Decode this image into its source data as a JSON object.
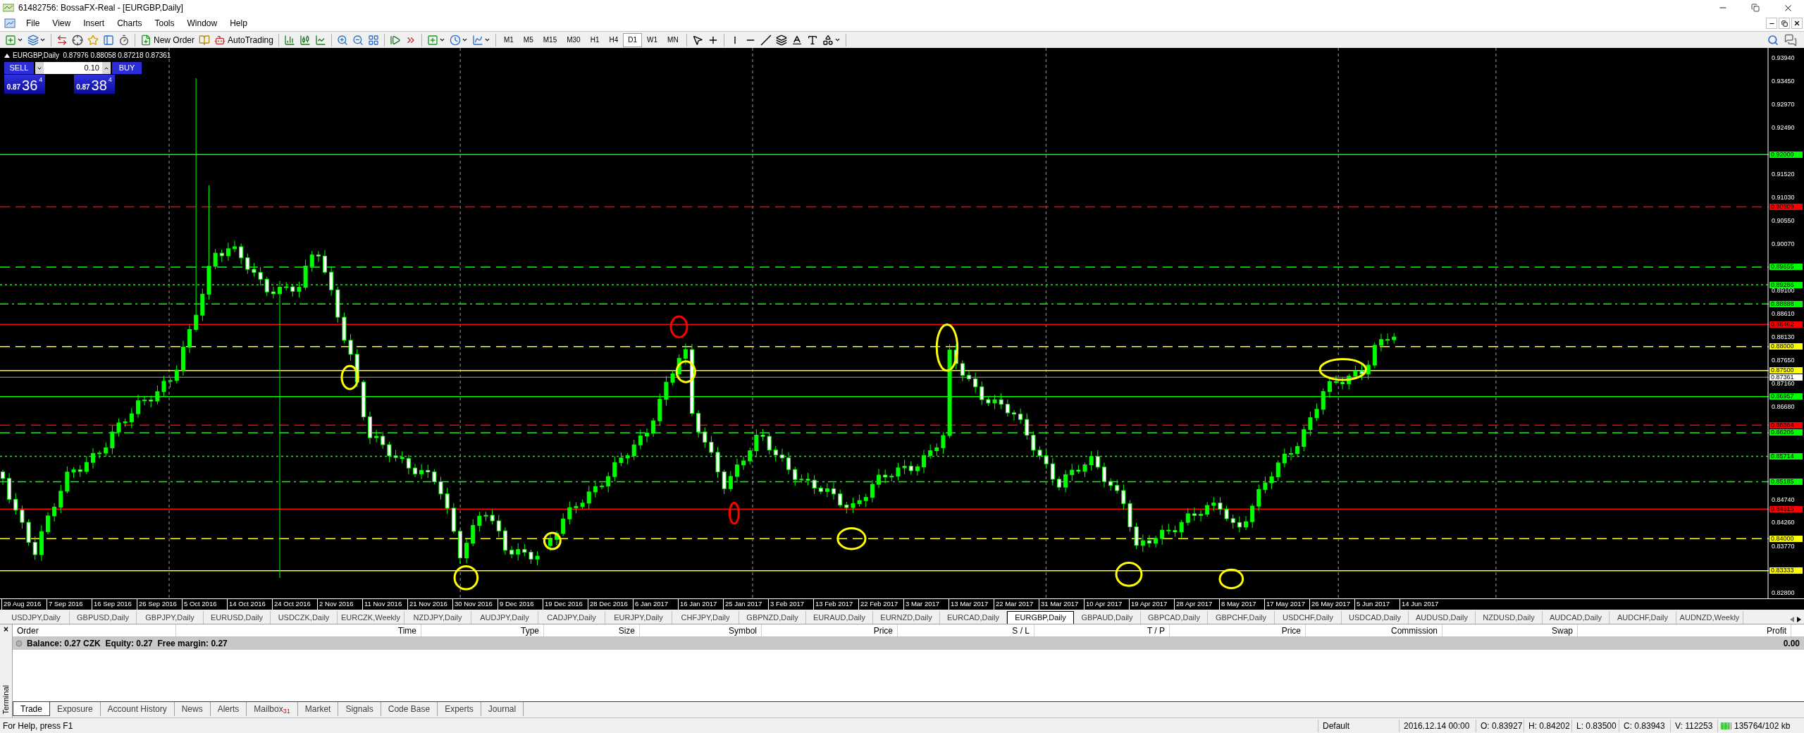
{
  "window": {
    "title": "61482756: BossaFX-Real - [EURGBP,Daily]"
  },
  "menu": [
    "File",
    "View",
    "Insert",
    "Charts",
    "Tools",
    "Window",
    "Help"
  ],
  "toolbar": {
    "new_order": "New Order",
    "auto_trading": "AutoTrading",
    "timeframes": [
      {
        "label": "M1",
        "selected": false
      },
      {
        "label": "M5",
        "selected": false
      },
      {
        "label": "M15",
        "selected": false
      },
      {
        "label": "M30",
        "selected": false
      },
      {
        "label": "H1",
        "selected": false
      },
      {
        "label": "H4",
        "selected": false
      },
      {
        "label": "D1",
        "selected": true
      },
      {
        "label": "W1",
        "selected": false
      },
      {
        "label": "MN",
        "selected": false
      }
    ]
  },
  "chart": {
    "header": "EURGBP,Daily  0.87976 0.88058 0.87218 0.87361",
    "one_click": {
      "sell": "SELL",
      "buy": "BUY",
      "lot": "0.10",
      "sell_price": {
        "prefix": "0.87",
        "big": "36",
        "sup": "4"
      },
      "buy_price": {
        "prefix": "0.87",
        "big": "38",
        "sup": "4"
      }
    },
    "price_ticks": [
      "0.93940",
      "0.93450",
      "0.92970",
      "0.92490",
      "0.91520",
      "0.91030",
      "0.90550",
      "0.90070",
      "0.89100",
      "0.88610",
      "0.88130",
      "0.87650",
      "0.87160",
      "0.86680",
      "0.84740",
      "0.84260",
      "0.83770",
      "0.82800"
    ],
    "levels": [
      {
        "price": "0.92000",
        "color": "#00ff00",
        "kind": "solid"
      },
      {
        "price": "0.90909",
        "color": "#ff0000",
        "kind": "dashed"
      },
      {
        "price": "0.89655",
        "color": "#00ff00",
        "kind": "dashed"
      },
      {
        "price": "0.89286",
        "color": "#00ff00",
        "kind": "dotted"
      },
      {
        "price": "0.88888",
        "color": "#00ff00",
        "kind": "dashdot"
      },
      {
        "price": "0.88462",
        "color": "#ff0000",
        "kind": "solid"
      },
      {
        "price": "0.88000",
        "color": "#ffff00",
        "kind": "dashed"
      },
      {
        "price": "0.87500",
        "color": "#ffff00",
        "kind": "solid"
      },
      {
        "price": "0.86957",
        "color": "#00ff00",
        "kind": "solid"
      },
      {
        "price": "0.86364",
        "color": "#ff0000",
        "kind": "dashed"
      },
      {
        "price": "0.86206",
        "color": "#00ff00",
        "kind": "dashed"
      },
      {
        "price": "0.85714",
        "color": "#00ff00",
        "kind": "dotted"
      },
      {
        "price": "0.85185",
        "color": "#00ff00",
        "kind": "dashdot"
      },
      {
        "price": "0.84615",
        "color": "#ff0000",
        "kind": "solid"
      },
      {
        "price": "0.84000",
        "color": "#ffff00",
        "kind": "dashed"
      },
      {
        "price": "0.83333",
        "color": "#ffff00",
        "kind": "solid"
      }
    ],
    "current_price": "0.87361",
    "dates": [
      "29 Aug 2016",
      "7 Sep 2016",
      "16 Sep 2016",
      "26 Sep 2016",
      "5 Oct 2016",
      "14 Oct 2016",
      "24 Oct 2016",
      "2 Nov 2016",
      "11 Nov 2016",
      "21 Nov 2016",
      "30 Nov 2016",
      "9 Dec 2016",
      "19 Dec 2016",
      "28 Dec 2016",
      "6 Jan 2017",
      "16 Jan 2017",
      "25 Jan 2017",
      "3 Feb 2017",
      "13 Feb 2017",
      "22 Feb 2017",
      "3 Mar 2017",
      "13 Mar 2017",
      "22 Mar 2017",
      "31 Mar 2017",
      "10 Apr 2017",
      "19 Apr 2017",
      "28 Apr 2017",
      "8 May 2017",
      "17 May 2017",
      "26 May 2017",
      "5 Jun 2017",
      "14 Jun 2017"
    ]
  },
  "chart_tabs": [
    {
      "label": "USDJPY,Daily",
      "selected": false
    },
    {
      "label": "GBPUSD,Daily",
      "selected": false
    },
    {
      "label": "GBPJPY,Daily",
      "selected": false
    },
    {
      "label": "EURUSD,Daily",
      "selected": false
    },
    {
      "label": "USDCZK,Daily",
      "selected": false
    },
    {
      "label": "EURCZK,Weekly",
      "selected": false
    },
    {
      "label": "NZDJPY,Daily",
      "selected": false
    },
    {
      "label": "AUDJPY,Daily",
      "selected": false
    },
    {
      "label": "CADJPY,Daily",
      "selected": false
    },
    {
      "label": "EURJPY,Daily",
      "selected": false
    },
    {
      "label": "CHFJPY,Daily",
      "selected": false
    },
    {
      "label": "GBPNZD,Daily",
      "selected": false
    },
    {
      "label": "EURAUD,Daily",
      "selected": false
    },
    {
      "label": "EURNZD,Daily",
      "selected": false
    },
    {
      "label": "EURCAD,Daily",
      "selected": false
    },
    {
      "label": "EURGBP,Daily",
      "selected": true
    },
    {
      "label": "GBPAUD,Daily",
      "selected": false
    },
    {
      "label": "GBPCAD,Daily",
      "selected": false
    },
    {
      "label": "GBPCHF,Daily",
      "selected": false
    },
    {
      "label": "USDCHF,Daily",
      "selected": false
    },
    {
      "label": "USDCAD,Daily",
      "selected": false
    },
    {
      "label": "AUDUSD,Daily",
      "selected": false
    },
    {
      "label": "NZDUSD,Daily",
      "selected": false
    },
    {
      "label": "AUDCAD,Daily",
      "selected": false
    },
    {
      "label": "AUDCHF,Daily",
      "selected": false
    },
    {
      "label": "AUDNZD,Weekly",
      "selected": false
    }
  ],
  "terminal": {
    "side_label": "Terminal",
    "close": "×",
    "columns": [
      "Order",
      "Time",
      "Type",
      "Size",
      "Symbol",
      "Price",
      "S / L",
      "T / P",
      "Price",
      "Commission",
      "Swap",
      "Profit"
    ],
    "balance": "Balance: 0.27 CZK  Equity: 0.27  Free margin: 0.27",
    "profit": "0.00",
    "tabs": [
      {
        "label": "Trade",
        "selected": true
      },
      {
        "label": "Exposure",
        "selected": false
      },
      {
        "label": "Account History",
        "selected": false
      },
      {
        "label": "News",
        "selected": false
      },
      {
        "label": "Alerts",
        "selected": false
      },
      {
        "label": "Mailbox",
        "selected": false,
        "badge": "31"
      },
      {
        "label": "Market",
        "selected": false
      },
      {
        "label": "Signals",
        "selected": false
      },
      {
        "label": "Code Base",
        "selected": false
      },
      {
        "label": "Experts",
        "selected": false
      },
      {
        "label": "Journal",
        "selected": false
      }
    ]
  },
  "status_bar": {
    "help": "For Help, press F1",
    "profile": "Default",
    "time": "2016.12.14 00:00",
    "open": "O: 0.83927",
    "high": "H: 0.84202",
    "low": "L: 0.83500",
    "close": "C: 0.83943",
    "volume": "V: 112253",
    "traffic": "135764/102 kb"
  }
}
